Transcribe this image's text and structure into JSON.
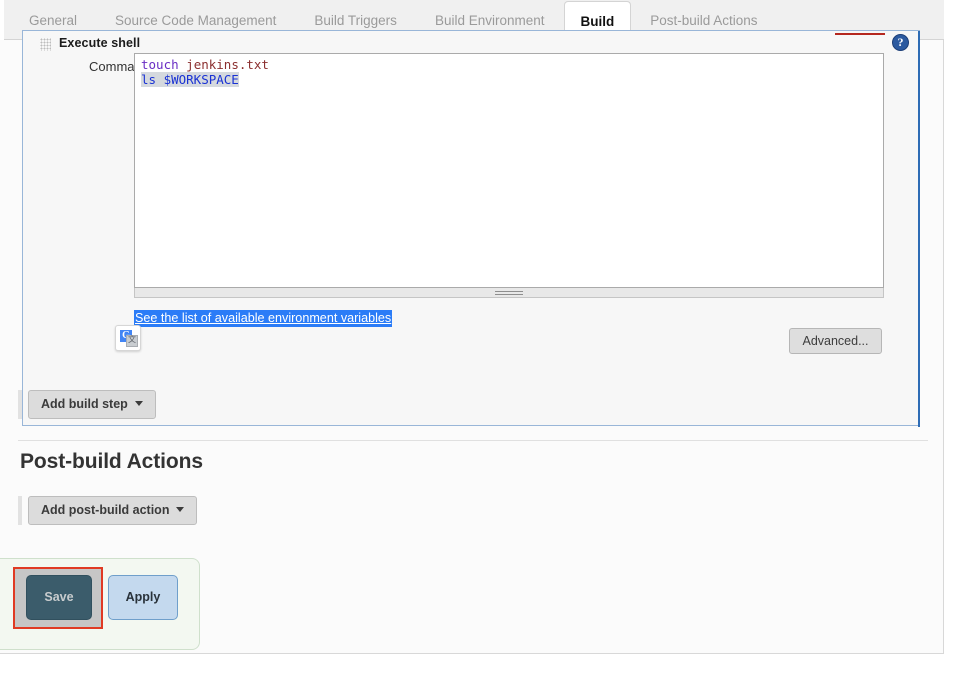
{
  "tabs": [
    {
      "label": "General",
      "active": false
    },
    {
      "label": "Source Code Management",
      "active": false
    },
    {
      "label": "Build Triggers",
      "active": false
    },
    {
      "label": "Build Environment",
      "active": false
    },
    {
      "label": "Build",
      "active": true
    },
    {
      "label": "Post-build Actions",
      "active": false
    }
  ],
  "build_step": {
    "title": "Execute shell",
    "help_icon": "question-mark-help-icon",
    "drag_handle_icon": "drag-grip-icon",
    "command_label": "Command",
    "command_value": "touch jenkins.txt\nls $WORKSPACE",
    "command_lines": [
      {
        "text": "touch",
        "token": "command"
      },
      {
        "text": " jenkins.txt",
        "token": "argument"
      },
      {
        "text": "ls $WORKSPACE",
        "token": "selected"
      }
    ],
    "env_link": "See the list of available environment variables",
    "advanced_button": "Advanced...",
    "translate_badge_icon": "google-translate-icon"
  },
  "add_build_step": {
    "label": "Add build step",
    "caret_icon": "chevron-down-icon"
  },
  "post_build": {
    "heading": "Post-build Actions",
    "add_action_label": "Add post-build action",
    "caret_icon": "chevron-down-icon"
  },
  "footer": {
    "save_label": "Save",
    "apply_label": "Apply"
  },
  "colors": {
    "accent_blue": "#2e6cb5",
    "save_bg": "#3b5c6b",
    "apply_bg": "#c4d9ee",
    "highlight_red": "#e03a23",
    "selection_blue": "#2b7cf7",
    "panel_green": "#f3f8f1"
  }
}
